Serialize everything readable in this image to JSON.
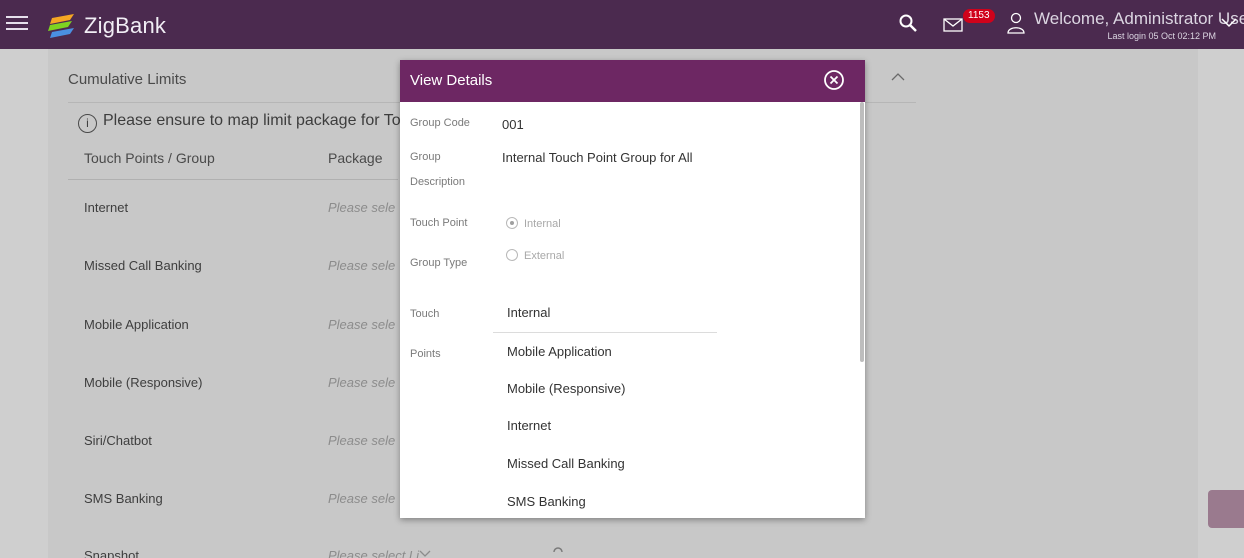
{
  "header": {
    "brand": "ZigBank",
    "notification_count": "1153",
    "welcome": "Welcome, Administrator User",
    "last_login": "Last login 05 Oct 02:12 PM"
  },
  "page": {
    "section_title": "Cumulative Limits",
    "info_text": "Please ensure to map limit package for Touc",
    "col_touch_points": "Touch Points / Group",
    "col_package": "Package",
    "rows": [
      {
        "label": "Internet",
        "package": "Please sele"
      },
      {
        "label": "Missed Call Banking",
        "package": "Please sele"
      },
      {
        "label": "Mobile Application",
        "package": "Please sele"
      },
      {
        "label": "Mobile (Responsive)",
        "package": "Please sele"
      },
      {
        "label": "Siri/Chatbot",
        "package": "Please sele"
      },
      {
        "label": "SMS Banking",
        "package": "Please sele"
      },
      {
        "label": "Snapshot",
        "package": "Please select Li"
      }
    ]
  },
  "modal": {
    "title": "View Details",
    "group_code_label": "Group Code",
    "group_code": "001",
    "group_desc_label_1": "Group",
    "group_desc_label_2": "Description",
    "group_desc": "Internal Touch Point Group for All",
    "tp_group_type_label_1": "Touch Point",
    "tp_group_type_label_2": "Group Type",
    "radio_internal": "Internal",
    "radio_external": "External",
    "touch_points_label_1": "Touch",
    "touch_points_label_2": "Points",
    "touch_points": [
      "Internal",
      "Mobile Application",
      "Mobile (Responsive)",
      "Internet",
      "Missed Call Banking",
      "SMS Banking"
    ]
  },
  "colors": {
    "header_bg": "#4b2a4f",
    "modal_header_bg": "#6d2763",
    "badge": "#d0021b"
  }
}
